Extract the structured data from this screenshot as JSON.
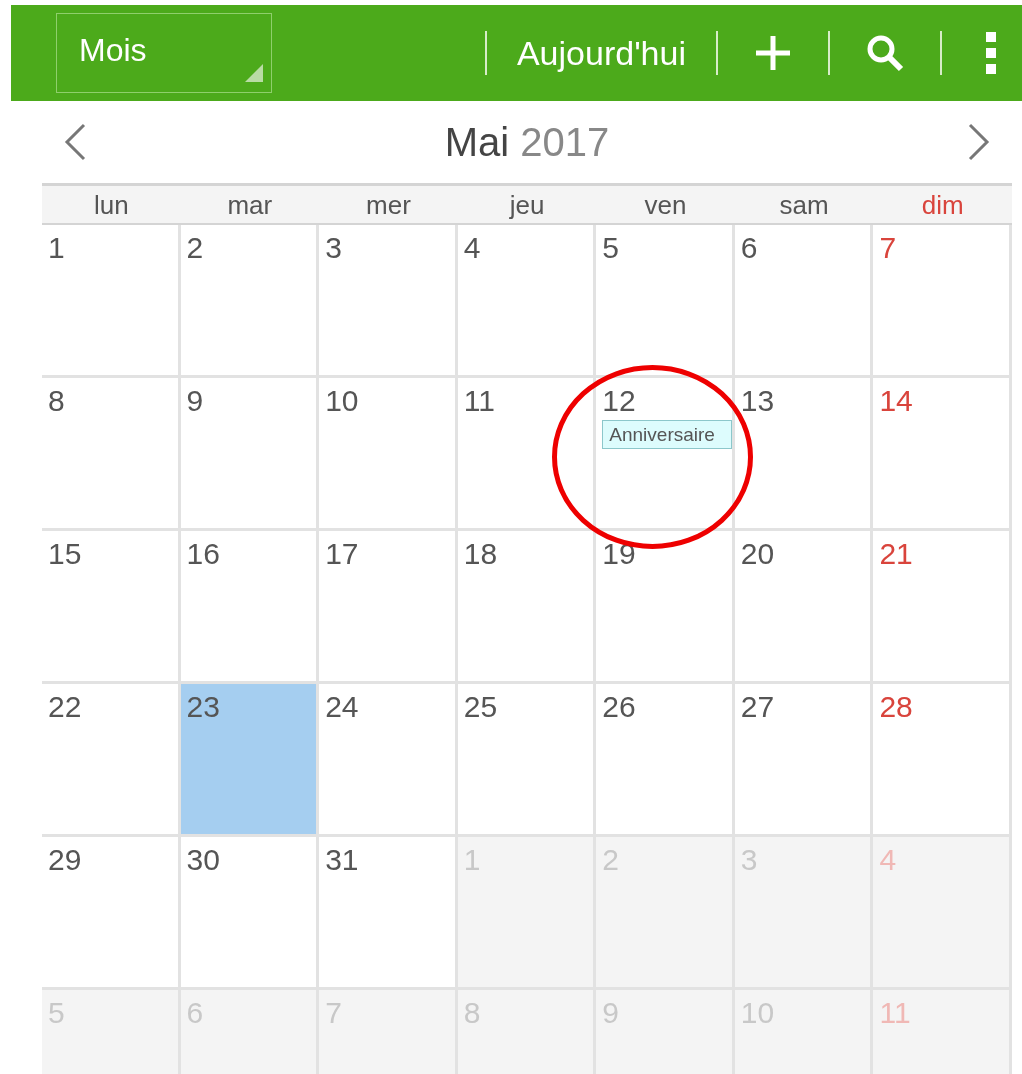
{
  "toolbar": {
    "view_selector": "Mois",
    "today_button": "Aujourd'hui"
  },
  "month_header": {
    "month": "Mai",
    "year": "2017"
  },
  "weekdays": [
    {
      "label": "lun",
      "weekend": false
    },
    {
      "label": "mar",
      "weekend": false
    },
    {
      "label": "mer",
      "weekend": false
    },
    {
      "label": "jeu",
      "weekend": false
    },
    {
      "label": "ven",
      "weekend": false
    },
    {
      "label": "sam",
      "weekend": false
    },
    {
      "label": "dim",
      "weekend": true
    }
  ],
  "weeks": [
    [
      {
        "day": "1",
        "other_month": false,
        "selected": false
      },
      {
        "day": "2",
        "other_month": false,
        "selected": false
      },
      {
        "day": "3",
        "other_month": false,
        "selected": false
      },
      {
        "day": "4",
        "other_month": false,
        "selected": false
      },
      {
        "day": "5",
        "other_month": false,
        "selected": false
      },
      {
        "day": "6",
        "other_month": false,
        "selected": false
      },
      {
        "day": "7",
        "other_month": false,
        "selected": false
      }
    ],
    [
      {
        "day": "8",
        "other_month": false,
        "selected": false
      },
      {
        "day": "9",
        "other_month": false,
        "selected": false
      },
      {
        "day": "10",
        "other_month": false,
        "selected": false
      },
      {
        "day": "11",
        "other_month": false,
        "selected": false
      },
      {
        "day": "12",
        "other_month": false,
        "selected": false,
        "events": [
          "Anniversaire"
        ]
      },
      {
        "day": "13",
        "other_month": false,
        "selected": false
      },
      {
        "day": "14",
        "other_month": false,
        "selected": false
      }
    ],
    [
      {
        "day": "15",
        "other_month": false,
        "selected": false
      },
      {
        "day": "16",
        "other_month": false,
        "selected": false
      },
      {
        "day": "17",
        "other_month": false,
        "selected": false
      },
      {
        "day": "18",
        "other_month": false,
        "selected": false
      },
      {
        "day": "19",
        "other_month": false,
        "selected": false
      },
      {
        "day": "20",
        "other_month": false,
        "selected": false
      },
      {
        "day": "21",
        "other_month": false,
        "selected": false
      }
    ],
    [
      {
        "day": "22",
        "other_month": false,
        "selected": false
      },
      {
        "day": "23",
        "other_month": false,
        "selected": true
      },
      {
        "day": "24",
        "other_month": false,
        "selected": false
      },
      {
        "day": "25",
        "other_month": false,
        "selected": false
      },
      {
        "day": "26",
        "other_month": false,
        "selected": false
      },
      {
        "day": "27",
        "other_month": false,
        "selected": false
      },
      {
        "day": "28",
        "other_month": false,
        "selected": false
      }
    ],
    [
      {
        "day": "29",
        "other_month": false,
        "selected": false
      },
      {
        "day": "30",
        "other_month": false,
        "selected": false
      },
      {
        "day": "31",
        "other_month": false,
        "selected": false
      },
      {
        "day": "1",
        "other_month": true,
        "selected": false
      },
      {
        "day": "2",
        "other_month": true,
        "selected": false
      },
      {
        "day": "3",
        "other_month": true,
        "selected": false
      },
      {
        "day": "4",
        "other_month": true,
        "selected": false
      }
    ],
    [
      {
        "day": "5",
        "other_month": true,
        "selected": false
      },
      {
        "day": "6",
        "other_month": true,
        "selected": false
      },
      {
        "day": "7",
        "other_month": true,
        "selected": false
      },
      {
        "day": "8",
        "other_month": true,
        "selected": false
      },
      {
        "day": "9",
        "other_month": true,
        "selected": false
      },
      {
        "day": "10",
        "other_month": true,
        "selected": false
      },
      {
        "day": "11",
        "other_month": true,
        "selected": false
      }
    ]
  ],
  "annotation": {
    "kind": "circle"
  }
}
